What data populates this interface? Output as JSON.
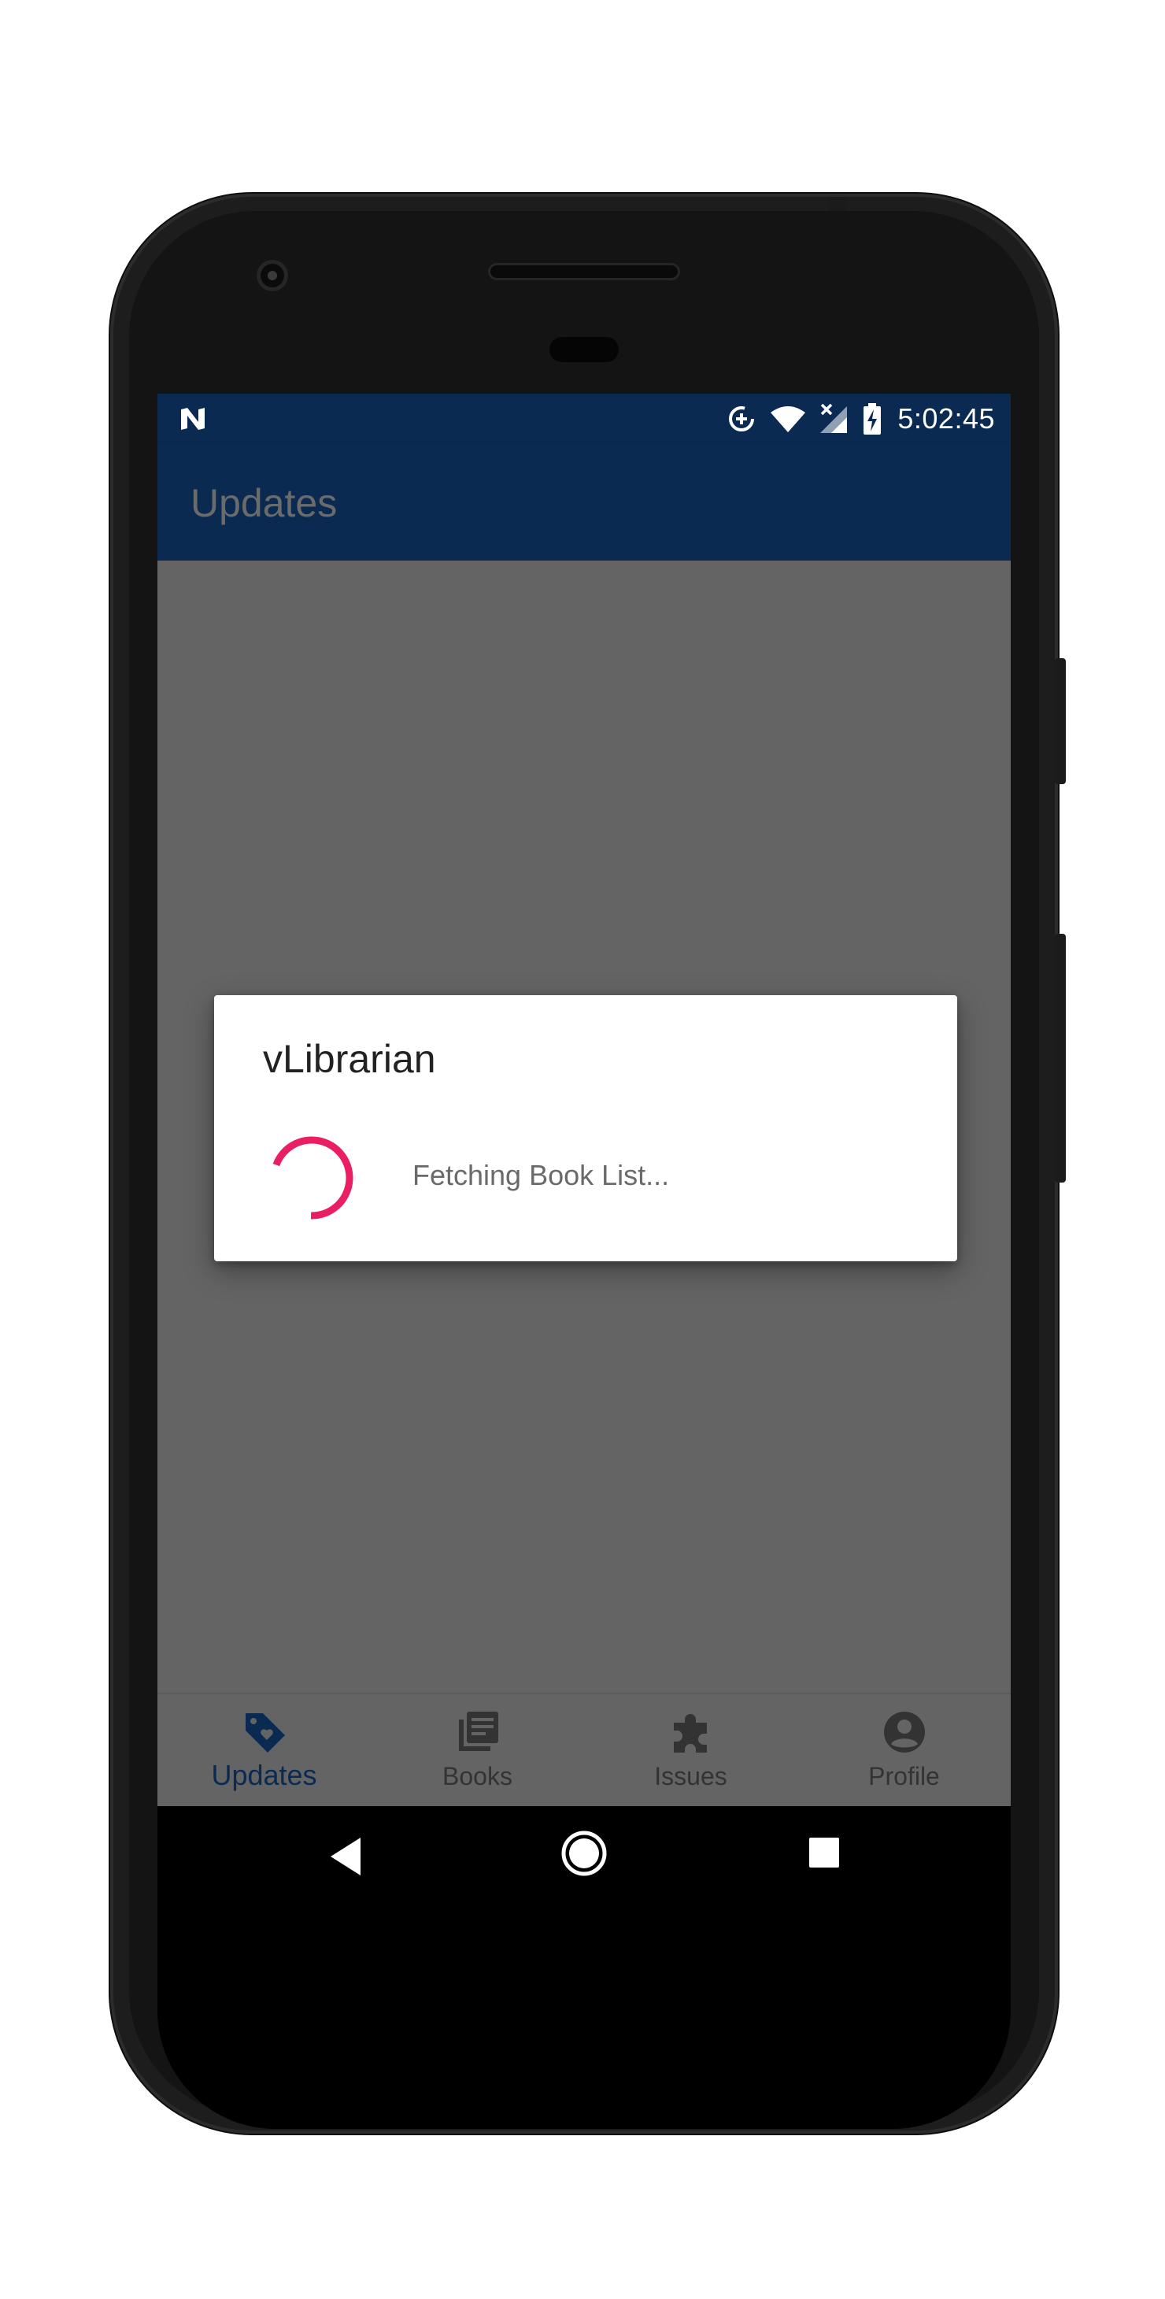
{
  "status_bar": {
    "time": "5:02:45",
    "icons": [
      "n-notification-icon",
      "data-saver-icon",
      "wifi-icon",
      "no-signal-icon",
      "battery-charging-icon"
    ]
  },
  "app_bar": {
    "title": "Updates"
  },
  "dialog": {
    "title": "vLibrarian",
    "message": "Fetching Book List..."
  },
  "bottom_nav": {
    "items": [
      {
        "label": "Updates",
        "icon": "tag-heart-icon",
        "active": true
      },
      {
        "label": "Books",
        "icon": "library-books-icon",
        "active": false
      },
      {
        "label": "Issues",
        "icon": "puzzle-icon",
        "active": false
      },
      {
        "label": "Profile",
        "icon": "account-circle-icon",
        "active": false
      }
    ]
  },
  "colors": {
    "primary": "#0b2a52",
    "accent": "#e91e63",
    "scrim": "#646464"
  }
}
